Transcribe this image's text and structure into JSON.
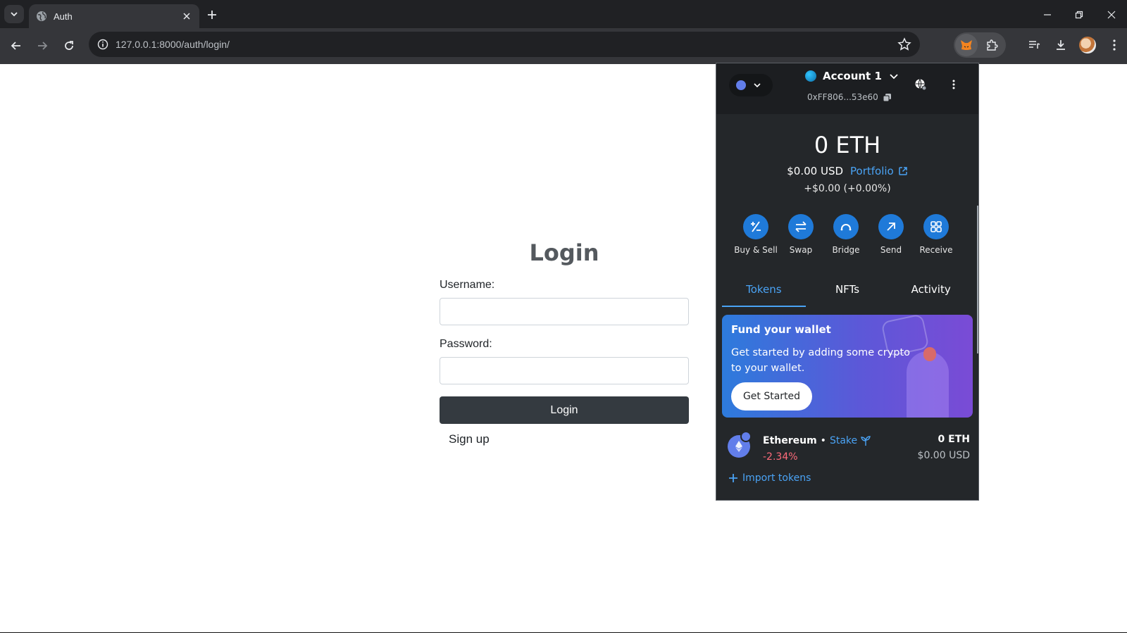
{
  "browser": {
    "tab_title": "Auth",
    "url": "127.0.0.1:8000/auth/login/"
  },
  "page": {
    "title": "Login",
    "username_label": "Username:",
    "password_label": "Password:",
    "submit_label": "Login",
    "signup_label": "Sign up"
  },
  "wallet": {
    "account_name": "Account 1",
    "address": "0xFF806...53e60",
    "balance": "0 ETH",
    "balance_usd": "$0.00 USD",
    "portfolio_label": "Portfolio",
    "change": "+$0.00 (+0.00%)",
    "actions": [
      "Buy & Sell",
      "Swap",
      "Bridge",
      "Send",
      "Receive"
    ],
    "tabs": [
      "Tokens",
      "NFTs",
      "Activity"
    ],
    "active_tab": "Tokens",
    "banner": {
      "title": "Fund your wallet",
      "text": "Get started by adding some crypto to your wallet.",
      "button": "Get Started"
    },
    "token": {
      "name": "Ethereum",
      "separator": "•",
      "stake_label": "Stake",
      "change": "-2.34%",
      "amount": "0 ETH",
      "usd": "$0.00 USD"
    },
    "import_label": "Import tokens"
  },
  "colors": {
    "accent": "#4aa3f5",
    "action_blue": "#1f7ad9",
    "negative": "#ff6b7a",
    "login_button": "#343a40"
  }
}
